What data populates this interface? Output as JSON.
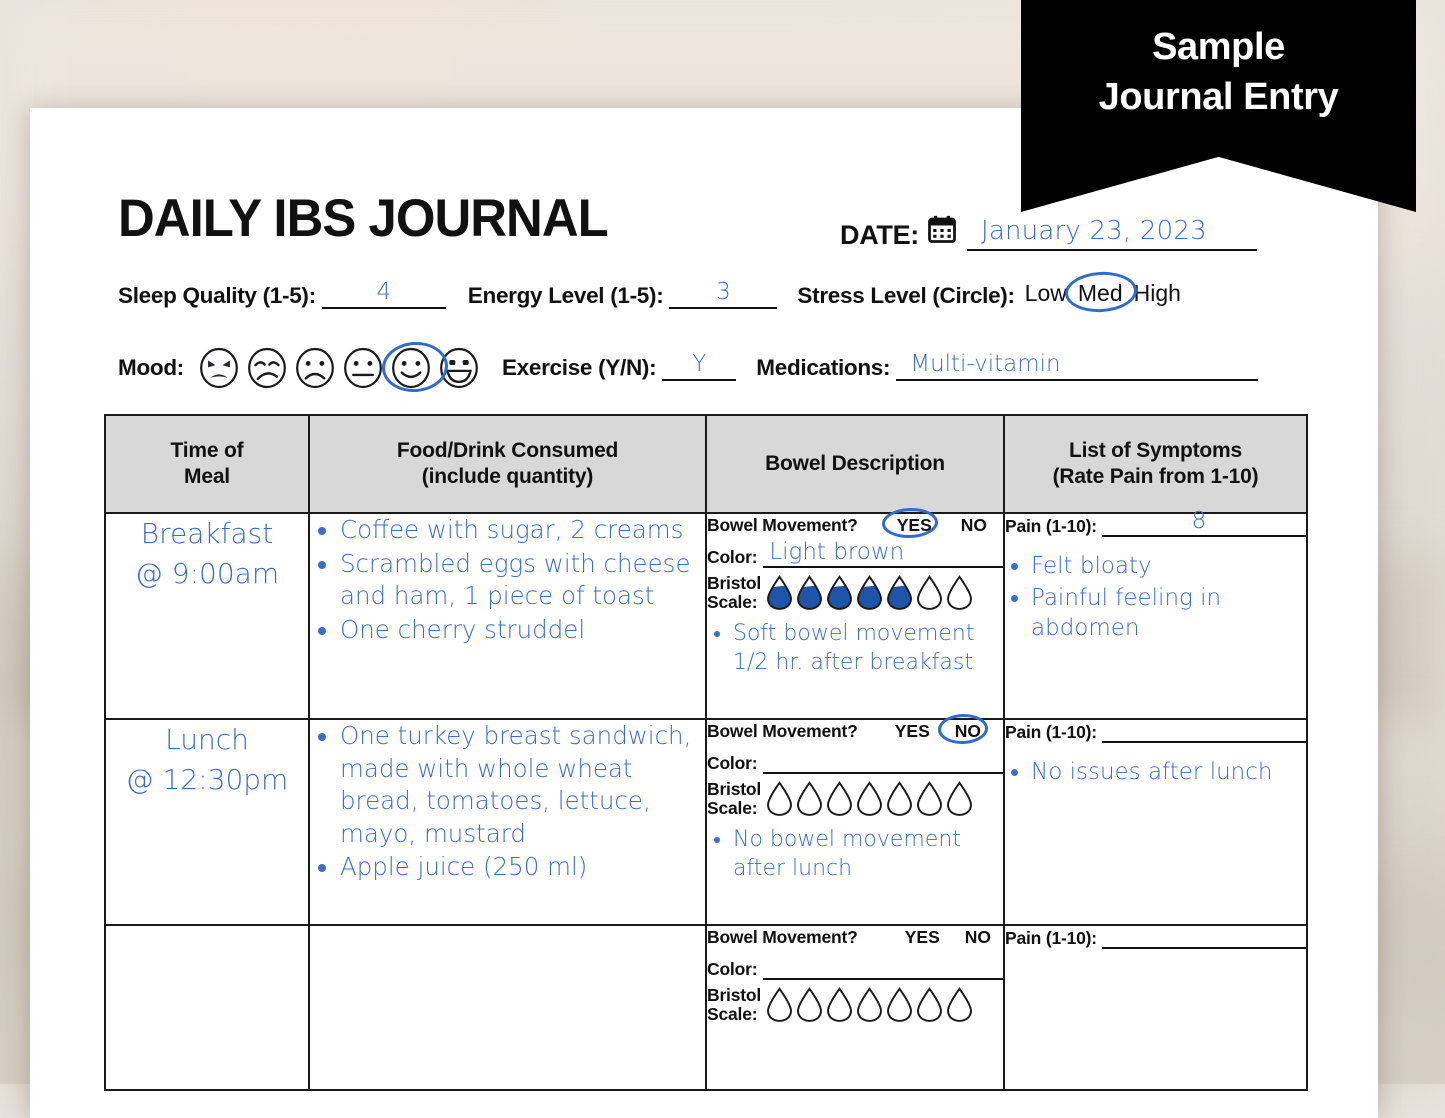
{
  "banner": {
    "line1": "Sample",
    "line2": "Journal Entry"
  },
  "header": {
    "title": "DAILY IBS JOURNAL",
    "date_label": "DATE:",
    "date_icon": "calendar-icon",
    "date_value": "January 23, 2023",
    "sleep_label": "Sleep Quality (1-5):",
    "sleep_value": "4",
    "energy_label": "Energy Level (1-5):",
    "energy_value": "3",
    "stress_label": "Stress Level (Circle):",
    "stress_options": [
      "Low",
      "Med",
      "High"
    ],
    "stress_selected": "Med",
    "mood_label": "Mood:",
    "mood_faces": [
      "angry",
      "very-sad",
      "sad",
      "neutral",
      "happy",
      "very-happy"
    ],
    "mood_selected_index": 4,
    "exercise_label": "Exercise (Y/N):",
    "exercise_value": "Y",
    "medications_label": "Medications:",
    "medications_value": "Multi-vitamin"
  },
  "table": {
    "columns": [
      "Time of\nMeal",
      "Food/Drink Consumed\n(include quantity)",
      "Bowel Description",
      "List of Symptoms\n(Rate Pain from 1-10)"
    ],
    "col_headers": {
      "time_l1": "Time of",
      "time_l2": "Meal",
      "food_l1": "Food/Drink Consumed",
      "food_l2": "(include quantity)",
      "bowel": "Bowel Description",
      "symptoms_l1": "List of Symptoms",
      "symptoms_l2": "(Rate Pain from 1-10)"
    },
    "labels": {
      "bowel_movement": "Bowel Movement?",
      "yes": "YES",
      "no": "NO",
      "color": "Color:",
      "bristol_l1": "Bristol",
      "bristol_l2": "Scale:",
      "pain": "Pain (1-10):"
    },
    "bristol_total": 7,
    "rows": [
      {
        "meal_name": "Breakfast",
        "meal_time": "@ 9:00am",
        "food_items": [
          "Coffee with sugar, 2 creams",
          "Scrambled eggs with cheese and ham, 1 piece of toast",
          "One cherry struddel"
        ],
        "bowel_movement": "YES",
        "color_value": "Light brown",
        "bristol_filled": 5,
        "bowel_notes": [
          "Soft bowel movement 1/2 hr. after breakfast"
        ],
        "pain_value": "8",
        "symptoms": [
          "Felt bloaty",
          "Painful feeling in abdomen"
        ]
      },
      {
        "meal_name": "Lunch",
        "meal_time": "@ 12:30pm",
        "food_items": [
          "One turkey breast sandwich, made with whole wheat bread, tomatoes, lettuce, mayo, mustard",
          "Apple juice (250 ml)"
        ],
        "bowel_movement": "NO",
        "color_value": "",
        "bristol_filled": 0,
        "bowel_notes": [
          "No bowel movement after lunch"
        ],
        "pain_value": "",
        "symptoms": [
          "No issues after lunch"
        ]
      },
      {
        "meal_name": "",
        "meal_time": "",
        "food_items": [],
        "bowel_movement": "",
        "color_value": "",
        "bristol_filled": 0,
        "bowel_notes": [],
        "pain_value": "",
        "symptoms": []
      }
    ]
  },
  "colors": {
    "ink_blue": "#3a6dd2",
    "scribble_blue": "#1f55a8",
    "header_fill": "#d8d8d8",
    "banner_bg": "#000000",
    "text_black": "#111111"
  }
}
